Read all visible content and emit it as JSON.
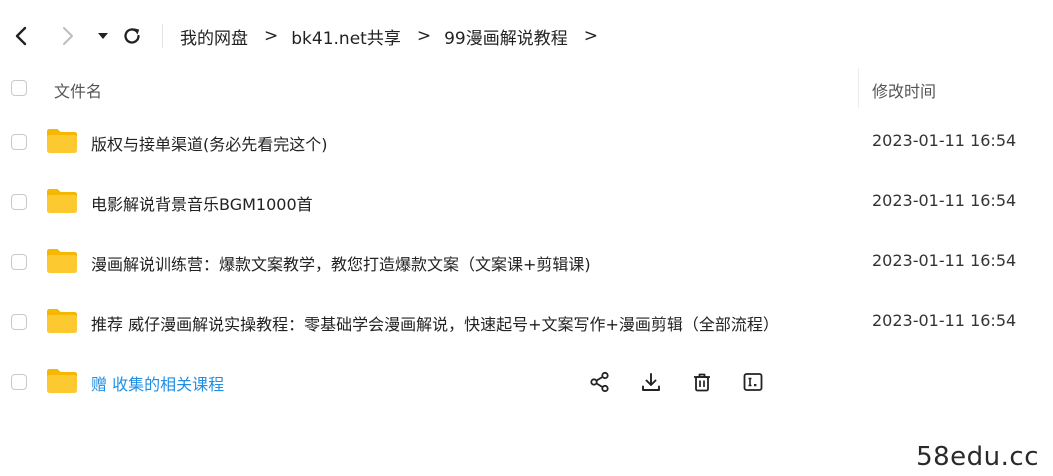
{
  "breadcrumb": [
    "我的网盘",
    "bk41.net共享",
    "99漫画解说教程"
  ],
  "breadcrumb_separator": ">",
  "columns": {
    "name": "文件名",
    "modified": "修改时间"
  },
  "files": [
    {
      "name": "版权与接单渠道(务必先看完这个)",
      "modified": "2023-01-11 16:54"
    },
    {
      "name": "电影解说背景音乐BGM1000首",
      "modified": "2023-01-11 16:54"
    },
    {
      "name": "漫画解说训练营：爆款文案教学，教您打造爆款文案（文案课+剪辑课)",
      "modified": "2023-01-11 16:54"
    },
    {
      "name": "推荐 威仔漫画解说实操教程：零基础学会漫画解说，快速起号+文案写作+漫画剪辑（全部流程）",
      "modified": "2023-01-11 16:54"
    },
    {
      "name": "赠  收集的相关课程",
      "modified": ""
    }
  ],
  "colors": {
    "folder": "#fcc931",
    "folder_tab": "#f5b800",
    "link": "#1f8fe5"
  },
  "icons": [
    "back-icon",
    "forward-icon",
    "dropdown-caret-icon",
    "refresh-icon",
    "folder-icon",
    "share-icon",
    "download-icon",
    "delete-icon",
    "rename-icon"
  ],
  "watermark": "58edu.cc"
}
